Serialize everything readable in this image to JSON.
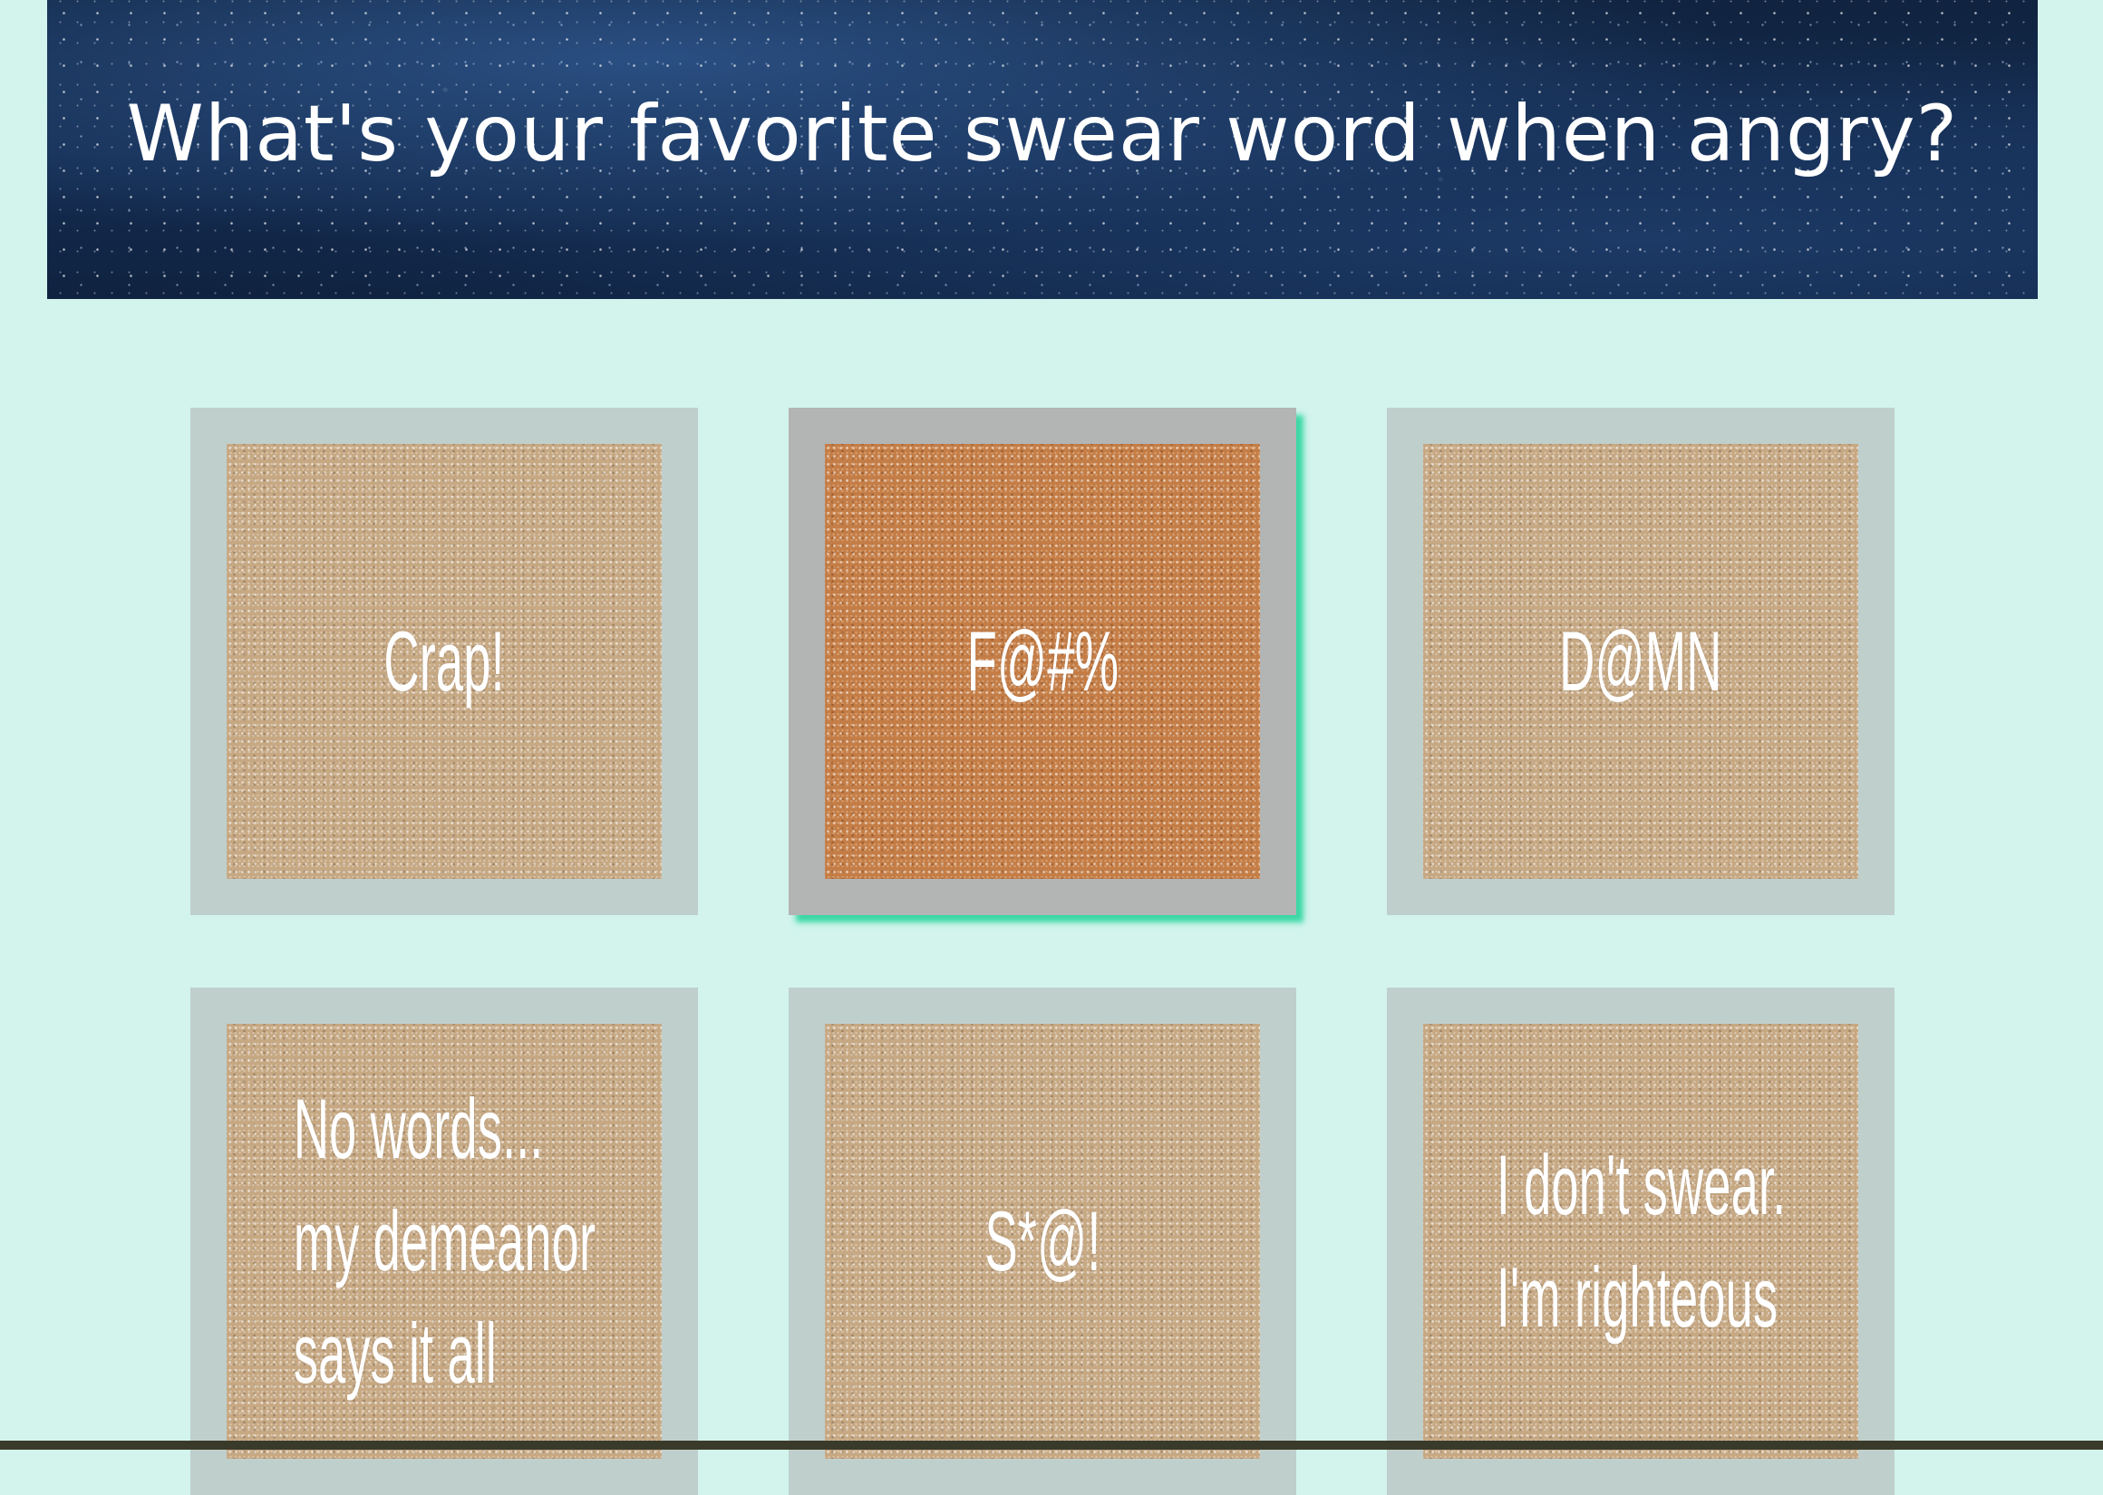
{
  "header": {
    "question": "What's your favorite swear word when angry?"
  },
  "options": [
    {
      "lines": [
        "Crap!"
      ]
    },
    {
      "lines": [
        "F@#%"
      ],
      "selected": true
    },
    {
      "lines": [
        "D@MN"
      ]
    },
    {
      "lines": [
        "No words...",
        "my demeanor",
        "says it all"
      ]
    },
    {
      "lines": [
        "S*@!"
      ]
    },
    {
      "lines": [
        "I don't swear.",
        "I'm righteous"
      ]
    }
  ],
  "colors": {
    "page_background": "#d2f4ec",
    "tile_frame": "#bfcfcc",
    "tile_frame_selected": "#b3b4b4",
    "selected_shadow": "#3ad8a4",
    "tile_face": "#c6a883",
    "tile_face_selected": "#c47d46"
  }
}
